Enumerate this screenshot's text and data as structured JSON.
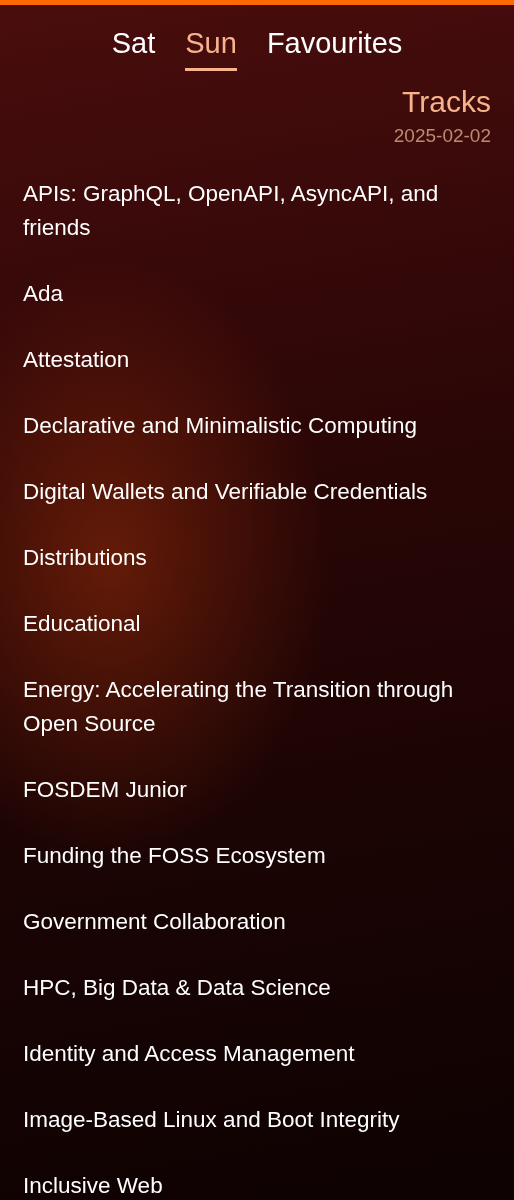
{
  "tabs": [
    {
      "label": "Sat",
      "selected": false
    },
    {
      "label": "Sun",
      "selected": true
    },
    {
      "label": "Favourites",
      "selected": false
    }
  ],
  "header": {
    "title": "Tracks",
    "subtitle": "2025-02-02"
  },
  "tracks": [
    {
      "name": "APIs: GraphQL, OpenAPI, AsyncAPI, and friends"
    },
    {
      "name": "Ada"
    },
    {
      "name": "Attestation"
    },
    {
      "name": "Declarative and Minimalistic Computing"
    },
    {
      "name": "Digital Wallets and Verifiable Credentials"
    },
    {
      "name": "Distributions"
    },
    {
      "name": "Educational"
    },
    {
      "name": "Energy: Accelerating the Transition through Open Source"
    },
    {
      "name": "FOSDEM Junior"
    },
    {
      "name": "Funding the FOSS Ecosystem"
    },
    {
      "name": "Government Collaboration"
    },
    {
      "name": "HPC, Big Data & Data Science"
    },
    {
      "name": "Identity and Access Management"
    },
    {
      "name": "Image-Based Linux and Boot Integrity"
    },
    {
      "name": "Inclusive Web"
    }
  ]
}
